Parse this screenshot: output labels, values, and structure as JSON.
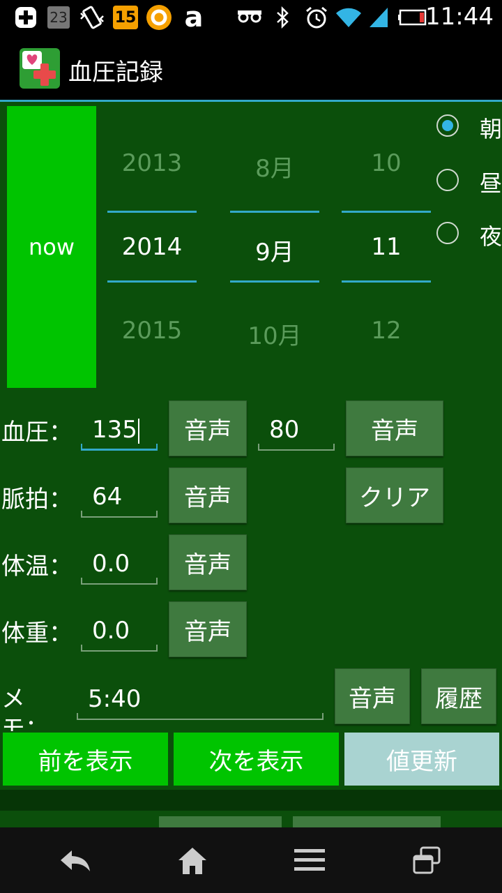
{
  "status_bar": {
    "time": "11:44",
    "notif_23": "23",
    "notif_15": "15",
    "notif_amazon": "a",
    "icons": [
      "plus-icon",
      "calendar-icon",
      "vibrate-icon",
      "badge-icon",
      "ring-icon",
      "amazon-icon",
      "voicemail-icon",
      "bluetooth-icon",
      "alarm-icon",
      "wifi-icon",
      "signal-icon",
      "battery-icon"
    ]
  },
  "app": {
    "title": "血圧記録"
  },
  "date_picker": {
    "now_label": "now",
    "year": {
      "prev": "2013",
      "current": "2014",
      "next": "2015"
    },
    "month": {
      "prev": "8月",
      "current": "9月",
      "next": "10月"
    },
    "day": {
      "prev": "10",
      "current": "11",
      "next": "12"
    }
  },
  "time_of_day": {
    "options": [
      "朝",
      "昼",
      "夜"
    ],
    "selected": "朝"
  },
  "form": {
    "bp_label": "血圧：",
    "systolic": "135",
    "diastolic": "80",
    "pulse_label": "脈拍：",
    "pulse": "64",
    "temp_label": "体温：",
    "temp": "0.0",
    "weight_label": "体重：",
    "weight": "0.0",
    "memo_label_1": "メ",
    "memo_label_2": "モ：",
    "memo": "5:40",
    "voice_label": "音声",
    "clear_label": "クリア",
    "history_label": "履歴"
  },
  "actions": {
    "prev_label": "前を表示",
    "next_label": "次を表示",
    "update_label": "値更新"
  },
  "colors": {
    "background": "#0b4f0b",
    "accent_green": "#00c400",
    "accent_blue": "#33a9c9",
    "update_button": "#a9d3d1",
    "button": "#3f7a3f"
  }
}
